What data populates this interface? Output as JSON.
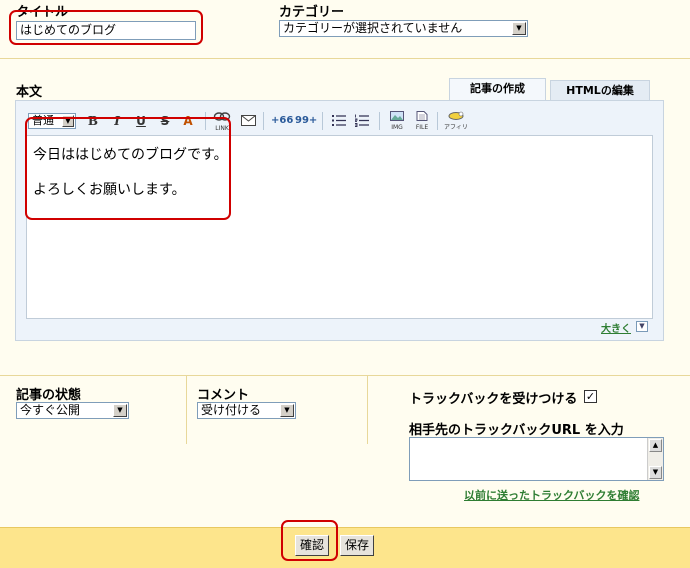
{
  "title_section": {
    "label": "タイトル",
    "value": "はじめてのブログ"
  },
  "category": {
    "label": "カテゴリー",
    "selected": "カテゴリーが選択されていません"
  },
  "body": {
    "label": "本文",
    "tabs": [
      {
        "label": "記事の作成",
        "active": true
      },
      {
        "label": "HTMLの編集",
        "active": false
      }
    ],
    "toolbar": {
      "font_size": "普通",
      "bold": "B",
      "italic": "I",
      "underline": "U",
      "strike": "S",
      "color": "A",
      "link_label": "LINK",
      "quote_open": "+66",
      "quote_close": "99+",
      "img_label": "IMG",
      "file_label": "FILE",
      "affiliate_label": "アフィリ"
    },
    "content_line1": "今日ははじめてのブログです。",
    "content_line2": "よろしくお願いします。",
    "enlarge_link": "大きく"
  },
  "status": {
    "label": "記事の状態",
    "selected": "今すぐ公開"
  },
  "comment": {
    "label": "コメント",
    "selected": "受け付ける"
  },
  "trackback": {
    "accept_label": "トラックバックを受けつける",
    "accept_checked": true,
    "url_label": "相手先のトラックバックURL を入力",
    "url_value": "",
    "history_link": "以前に送ったトラックバックを確認"
  },
  "actions": {
    "confirm": "確認",
    "save": "保存"
  },
  "colors": {
    "background": "#fffdf0",
    "footer": "#fde58c",
    "highlight": "#d00000",
    "link": "#2e7d32"
  }
}
